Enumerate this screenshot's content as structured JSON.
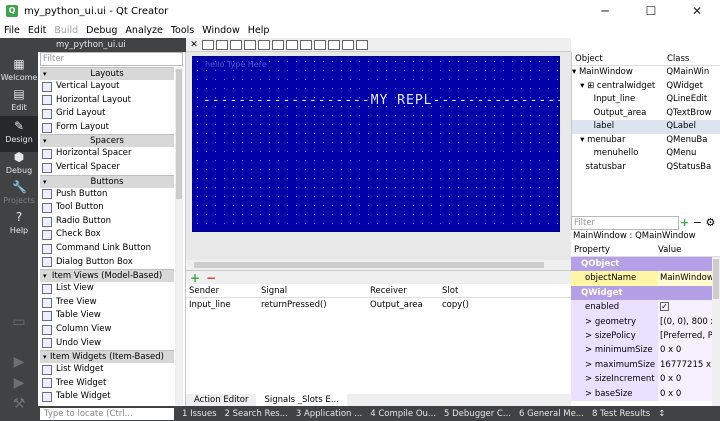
{
  "window": {
    "title": "my_python_ui.ui - Qt Creator",
    "minimize": "─",
    "maximize": "☐",
    "close": "✕"
  },
  "menu": [
    "File",
    "Edit",
    "Build",
    "Debug",
    "Analyze",
    "Tools",
    "Window",
    "Help"
  ],
  "modes": [
    {
      "label": "Welcome",
      "icon": "▦"
    },
    {
      "label": "Edit",
      "icon": "▤"
    },
    {
      "label": "Design",
      "icon": "✎"
    },
    {
      "label": "Debug",
      "icon": "⬢"
    },
    {
      "label": "Projects",
      "icon": "🔧"
    },
    {
      "label": "Help",
      "icon": "?"
    }
  ],
  "file_tab": "my_python_ui.ui",
  "widget_box": {
    "filter_placeholder": "Filter",
    "categories": [
      {
        "name": "Layouts",
        "items": [
          "Vertical Layout",
          "Horizontal Layout",
          "Grid Layout",
          "Form Layout"
        ]
      },
      {
        "name": "Spacers",
        "items": [
          "Horizontal Spacer",
          "Vertical Spacer"
        ]
      },
      {
        "name": "Buttons",
        "items": [
          "Push Button",
          "Tool Button",
          "Radio Button",
          "Check Box",
          "Command Link Button",
          "Dialog Button Box"
        ]
      },
      {
        "name": "Item Views (Model-Based)",
        "items": [
          "List View",
          "Tree View",
          "Table View",
          "Column View",
          "Undo View"
        ]
      },
      {
        "name": "Item Widgets (Item-Based)",
        "items": [
          "List Widget",
          "Tree Widget",
          "Table Widget"
        ]
      }
    ]
  },
  "form": {
    "menubar_text": "hello   Type Here",
    "label_text": "-------------------MY REPL-------------------"
  },
  "signals": {
    "headers": [
      "Sender",
      "Signal",
      "Receiver",
      "Slot"
    ],
    "rows": [
      [
        "Input_line",
        "returnPressed()",
        "Output_area",
        "copy()"
      ]
    ],
    "plus": "+",
    "minus": "−"
  },
  "bottom_tabs": [
    "Action Editor",
    "Signals _Slots E..."
  ],
  "object_inspector": {
    "headers": [
      "Object",
      "Class"
    ],
    "rows": [
      {
        "name": "▾ MainWindow",
        "cls": "QMainWin"
      },
      {
        "name": "   ▾ ⊞ centralwidget",
        "cls": "QWidget"
      },
      {
        "name": "        Input_line",
        "cls": "QLineEdit"
      },
      {
        "name": "        Output_area",
        "cls": "QTextBrow"
      },
      {
        "name": "        label",
        "cls": "QLabel"
      },
      {
        "name": "   ▾ menubar",
        "cls": "QMenuBa"
      },
      {
        "name": "        menuhello",
        "cls": "QMenu"
      },
      {
        "name": "     statusbar",
        "cls": "QStatusBa"
      }
    ]
  },
  "property_editor": {
    "filter_placeholder": "Filter",
    "class_line": "MainWindow : QMainWindow",
    "headers": [
      "Property",
      "Value"
    ],
    "tools": "+ − ⚙",
    "rows": [
      {
        "type": "section",
        "name": "QObject"
      },
      {
        "type": "yellow",
        "name": "objectName",
        "value": "MainWindow"
      },
      {
        "type": "section",
        "name": "QWidget"
      },
      {
        "type": "purple",
        "name": "enabled",
        "value": "✓"
      },
      {
        "type": "purple",
        "name": "> geometry",
        "value": "[(0, 0), 800 x"
      },
      {
        "type": "purple",
        "name": "> sizePolicy",
        "value": "[Preferred, P"
      },
      {
        "type": "purple",
        "name": "> minimumSize",
        "value": "0 x 0"
      },
      {
        "type": "purple",
        "name": "> maximumSize",
        "value": "16777215 x"
      },
      {
        "type": "purple",
        "name": "> sizeIncrement",
        "value": "0 x 0"
      },
      {
        "type": "purple",
        "name": "> baseSize",
        "value": "0 x 0"
      }
    ]
  },
  "statusbar": {
    "locator_placeholder": "Type to locate (Ctrl...",
    "items": [
      "1 Issues",
      "2 Search Res...",
      "3 Application ...",
      "4 Compile Ou...",
      "5 Debugger C...",
      "6 General Me...",
      "8 Test Results",
      "↕"
    ]
  }
}
